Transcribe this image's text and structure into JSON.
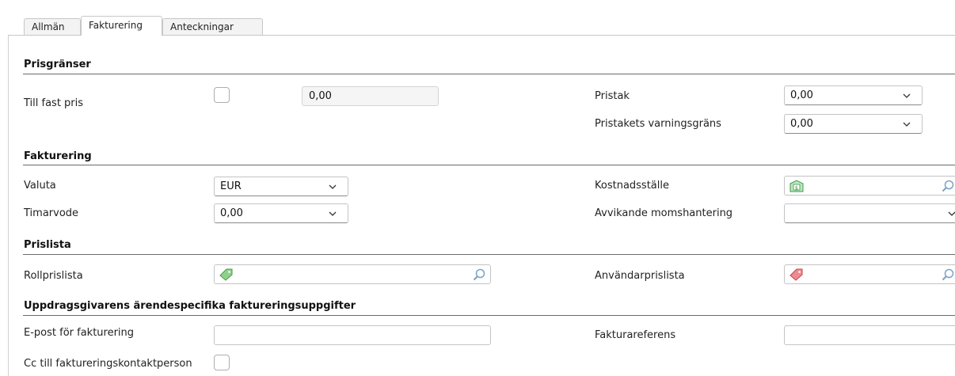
{
  "tabs": [
    {
      "label": "Allmän",
      "active": false
    },
    {
      "label": "Fakturering",
      "active": true
    },
    {
      "label": "Anteckningar",
      "active": false
    }
  ],
  "sections": {
    "prisgranser": "Prisgränser",
    "fakturering": "Fakturering",
    "prislista": "Prislista",
    "uppdrag": "Uppdragsgivarens ärendespecifika faktureringsuppgifter"
  },
  "prisgranser": {
    "till_fast_pris_label": "Till fast pris",
    "till_fast_pris_checked": false,
    "fast_pris_value": "0,00",
    "pristak_label": "Pristak",
    "pristak_value": "0,00",
    "varningsgrans_label": "Pristakets varningsgräns",
    "varningsgrans_value": "0,00"
  },
  "fakturering": {
    "valuta_label": "Valuta",
    "valuta_value": "EUR",
    "timarvode_label": "Timarvode",
    "timarvode_value": "0,00",
    "kostnadsstalle_label": "Kostnadsställe",
    "kostnadsstalle_value": "",
    "momshantering_label": "Avvikande momshantering",
    "momshantering_value": ""
  },
  "prislista": {
    "rollprislista_label": "Rollprislista",
    "rollprislista_value": "",
    "anvandarprislista_label": "Användarprislista",
    "anvandarprislista_value": ""
  },
  "uppdrag": {
    "epost_label": "E-post för fakturering",
    "epost_value": "",
    "fakturareferens_label": "Fakturareferens",
    "fakturareferens_value": "",
    "cc_label": "Cc till faktureringskontaktperson",
    "cc_checked": false
  },
  "icons": {
    "chevron": "chevron-down-icon",
    "search": "search-icon",
    "cost_center": "cost-center-icon",
    "price_tag_green": "price-tag-green-icon",
    "price_tag_red": "price-tag-red-icon"
  },
  "colors": {
    "tag_green": "#6fbf6b",
    "tag_red": "#e0606a",
    "cost_green": "#3a9a4a"
  }
}
